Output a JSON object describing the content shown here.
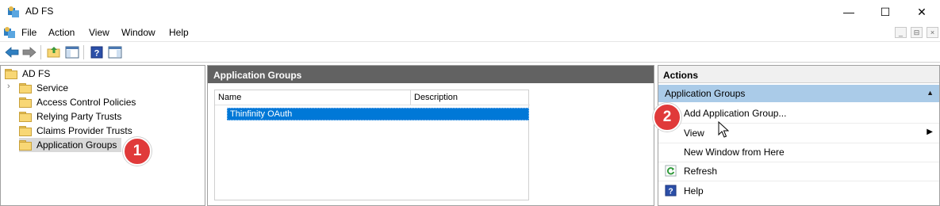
{
  "window": {
    "title": "AD FS",
    "controls": {
      "minimize": "—",
      "maximize": "☐",
      "close": "✕"
    }
  },
  "menubar": {
    "items": [
      "File",
      "Action",
      "View",
      "Window",
      "Help"
    ],
    "mdi_controls": [
      "_",
      "⊟",
      "×"
    ]
  },
  "toolbar": {
    "icons": [
      "back-arrow-icon",
      "forward-arrow-icon",
      "up-folder-icon",
      "show-hide-console-tree-icon",
      "help-icon",
      "show-hide-action-pane-icon"
    ]
  },
  "tree": {
    "root": "AD FS",
    "items": [
      {
        "label": "Service"
      },
      {
        "label": "Access Control Policies"
      },
      {
        "label": "Relying Party Trusts"
      },
      {
        "label": "Claims Provider Trusts"
      },
      {
        "label": "Application Groups",
        "selected": true
      }
    ]
  },
  "middle": {
    "header": "Application Groups",
    "columns": [
      "Name",
      "Description"
    ],
    "rows": [
      {
        "name": "Thinfinity OAuth",
        "description": ""
      }
    ]
  },
  "actions": {
    "header": "Actions",
    "group": "Application Groups",
    "items": [
      {
        "label": "Add Application Group...",
        "icon": ""
      },
      {
        "label": "View",
        "icon": "",
        "submenu": true
      },
      {
        "label": "New Window from Here",
        "icon": ""
      },
      {
        "label": "Refresh",
        "icon": "refresh-icon"
      },
      {
        "label": "Help",
        "icon": "help-icon"
      }
    ]
  },
  "annotations": {
    "badge1": "1",
    "badge2": "2"
  },
  "colors": {
    "selection": "#0078d7",
    "actions_group_bg": "#aacbe8",
    "pane_header_bg": "#626262",
    "badge": "#e03a3a"
  }
}
